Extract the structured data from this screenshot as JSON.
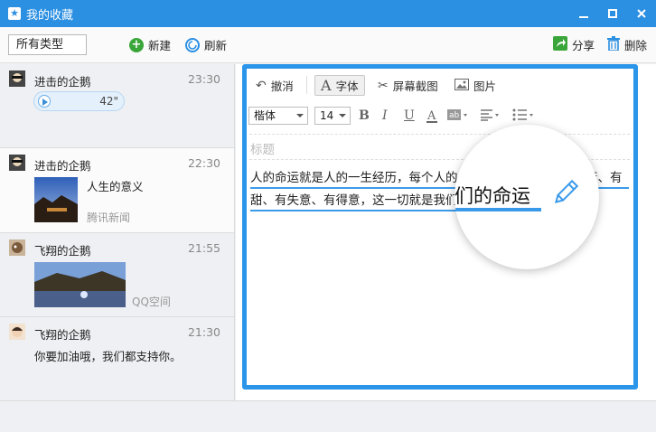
{
  "window": {
    "title": "我的收藏",
    "controls": [
      "minimize",
      "maximize",
      "close"
    ]
  },
  "toolbar": {
    "type_filter": "所有类型",
    "new_label": "新建",
    "refresh_label": "刷新",
    "share_label": "分享",
    "delete_label": "删除"
  },
  "list": [
    {
      "user": "进击的企鹅",
      "time": "23:30",
      "kind": "voice",
      "duration": "42\""
    },
    {
      "user": "进击的企鹅",
      "time": "22:30",
      "kind": "news",
      "title": "人生的意义",
      "source": "腾讯新闻"
    },
    {
      "user": "飞翔的企鹅",
      "time": "21:55",
      "kind": "image",
      "source": "QQ空间"
    },
    {
      "user": "飞翔的企鹅",
      "time": "21:30",
      "kind": "text",
      "text": "你要加油哦，我们都支持你。"
    }
  ],
  "editor": {
    "undo_label": "撤消",
    "font_label": "字体",
    "screenshot_label": "屏幕截图",
    "image_label": "图片",
    "font_family": "楷体",
    "font_size": "14",
    "title_placeholder": "标题",
    "body_line1": "人的命运就是人的一生经历，每个人的",
    "body_line1_tail": "苦、有",
    "body_line2": "甜、有失意、有得意，这一切就是我们的命运",
    "magnifier_text": "们的命运"
  },
  "colors": {
    "accent": "#2b8fe2",
    "editor_border": "#2b95ea",
    "underline": "#3a9aea",
    "new_icon": "#3aa63a"
  }
}
